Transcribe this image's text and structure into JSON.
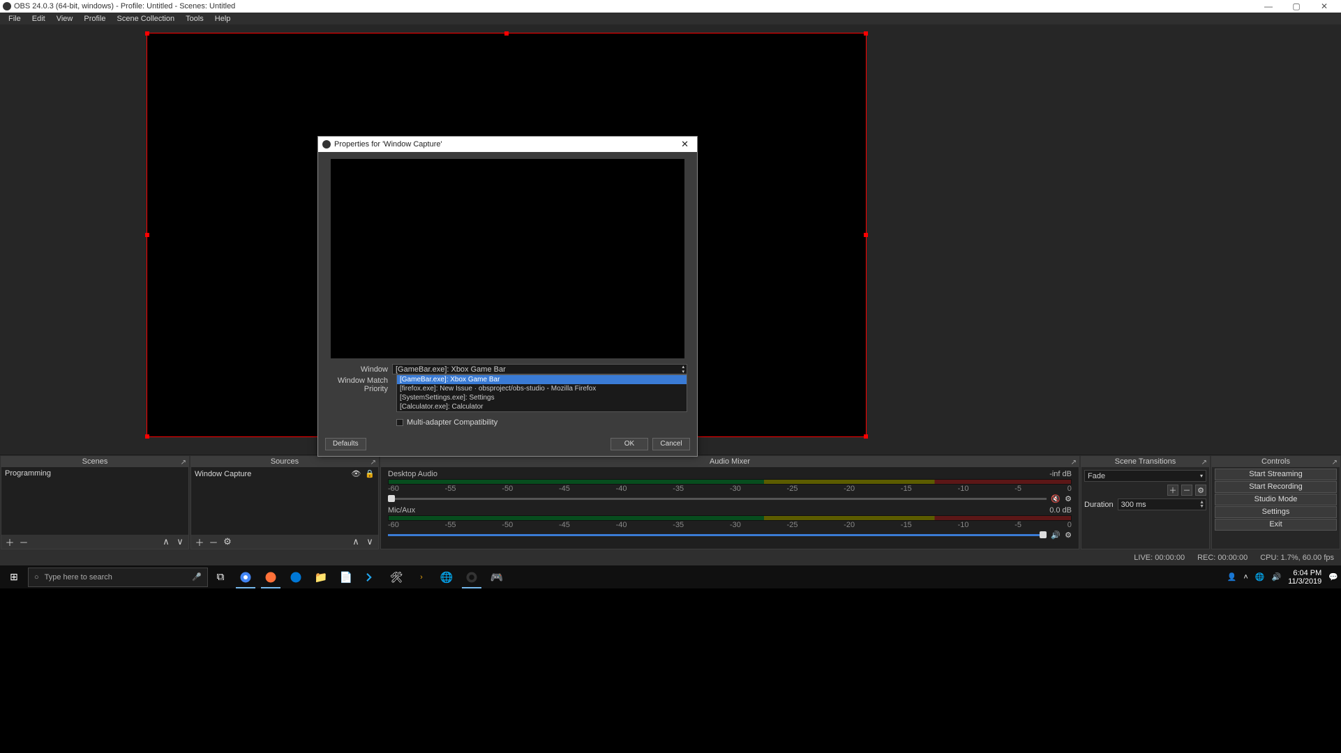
{
  "window": {
    "title": "OBS 24.0.3 (64-bit, windows) - Profile: Untitled - Scenes: Untitled",
    "min": "—",
    "max": "▢",
    "close": "✕"
  },
  "menu": {
    "items": [
      "File",
      "Edit",
      "View",
      "Profile",
      "Scene Collection",
      "Tools",
      "Help"
    ]
  },
  "panels": {
    "scenes": {
      "title": "Scenes",
      "item": "Programming"
    },
    "sources": {
      "title": "Sources",
      "item": "Window Capture"
    },
    "mixer": {
      "title": "Audio Mixer",
      "track1": {
        "name": "Desktop Audio",
        "db": "-inf dB"
      },
      "track2": {
        "name": "Mic/Aux",
        "db": "0.0 dB"
      },
      "ticks": [
        "-60",
        "-55",
        "-50",
        "-45",
        "-40",
        "-35",
        "-30",
        "-25",
        "-20",
        "-15",
        "-10",
        "-5",
        "0"
      ]
    },
    "trans": {
      "title": "Scene Transitions",
      "sel": "Fade",
      "dur_label": "Duration",
      "dur_val": "300 ms"
    },
    "controls": {
      "title": "Controls",
      "btns": [
        "Start Streaming",
        "Start Recording",
        "Studio Mode",
        "Settings",
        "Exit"
      ]
    }
  },
  "status": {
    "live": "LIVE: 00:00:00",
    "rec": "REC: 00:00:00",
    "cpu": "CPU: 1.7%, 60.00 fps"
  },
  "taskbar": {
    "search_placeholder": "Type here to search",
    "clock_time": "6:04 PM",
    "clock_date": "11/3/2019"
  },
  "dialog": {
    "title": "Properties for 'Window Capture'",
    "window_label": "Window",
    "window_selected": "[GameBar.exe]: Xbox Game Bar",
    "priority_label": "Window Match Priority",
    "options": [
      "[GameBar.exe]: Xbox Game Bar",
      "[firefox.exe]: New Issue · obsproject/obs-studio - Mozilla Firefox",
      "[SystemSettings.exe]: Settings",
      "[Calculator.exe]: Calculator"
    ],
    "chk": "Multi-adapter Compatibility",
    "defaults": "Defaults",
    "ok": "OK",
    "cancel": "Cancel"
  }
}
